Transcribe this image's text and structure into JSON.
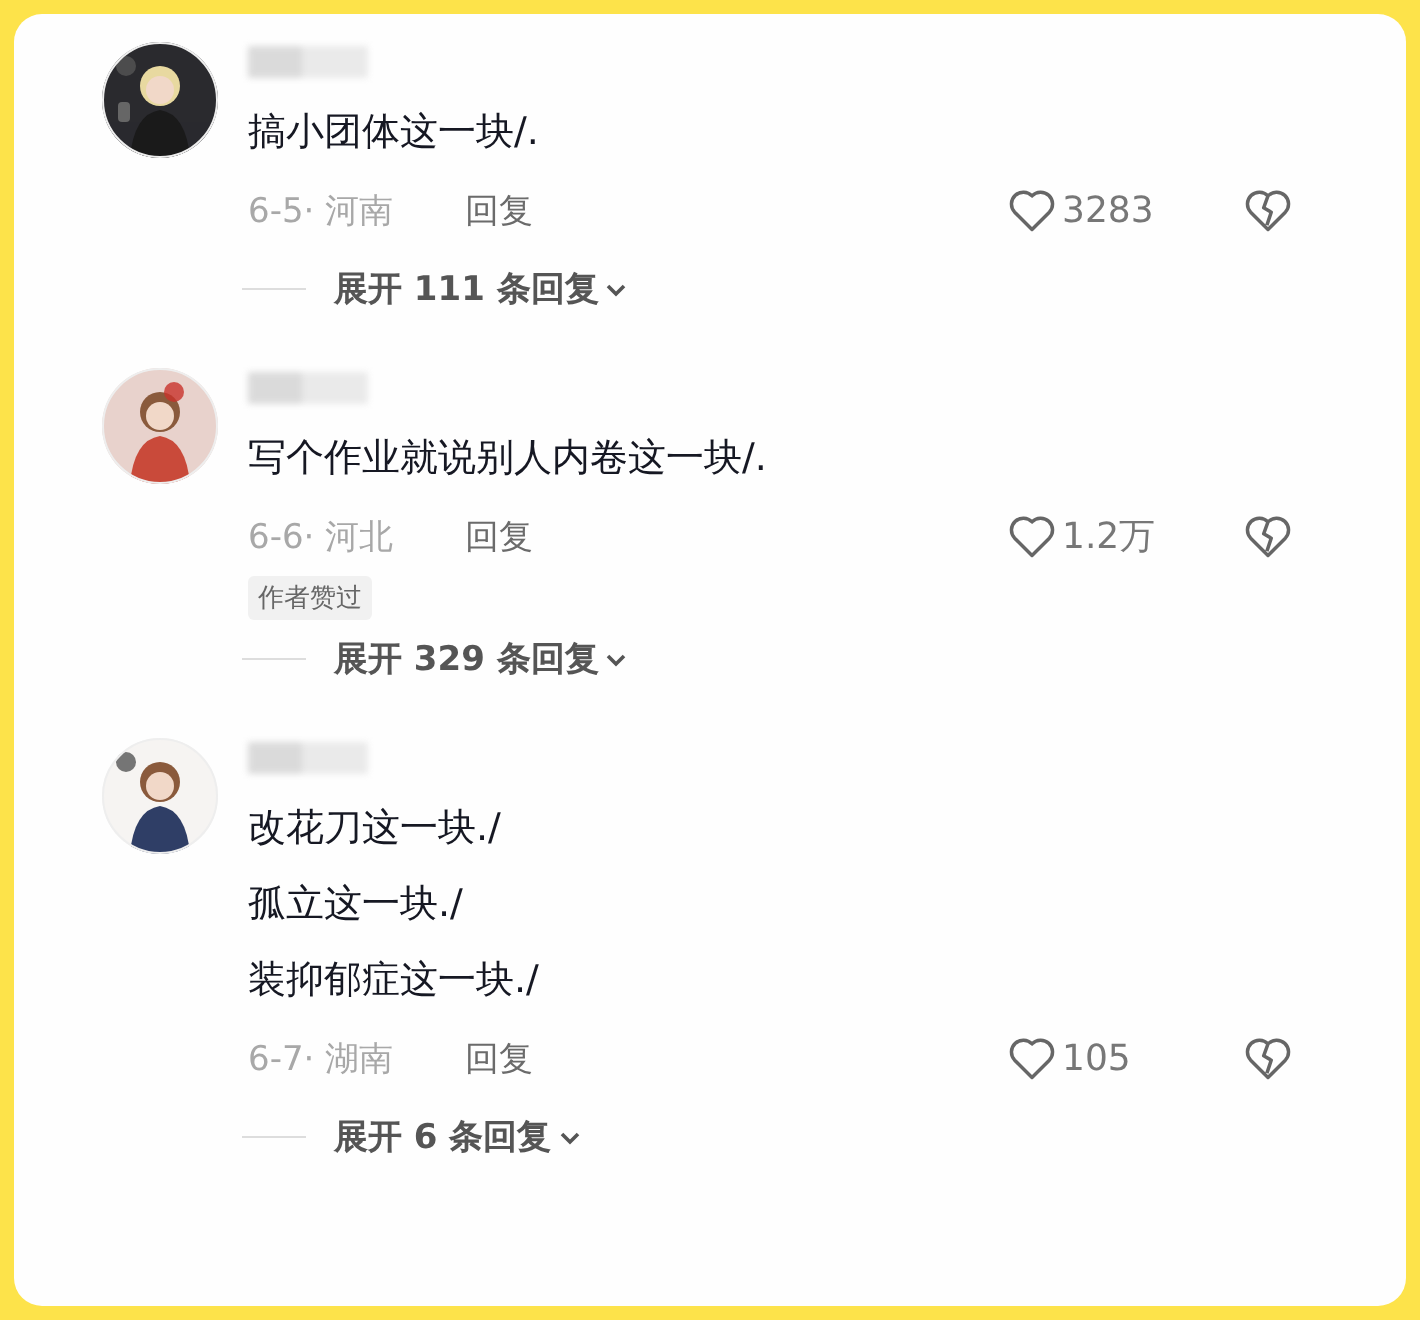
{
  "comments": [
    {
      "lines": [
        "搞小团体这一块/."
      ],
      "date_region": "6-5· 河南",
      "reply": "回复",
      "likes": "3283",
      "expand": "展开 111 条回复"
    },
    {
      "lines": [
        "写个作业就说别人内卷这一块/."
      ],
      "date_region": "6-6· 河北",
      "reply": "回复",
      "likes": "1.2万",
      "badge": "作者赞过",
      "expand": "展开 329 条回复"
    },
    {
      "lines": [
        "改花刀这一块./",
        "孤立这一块./",
        "装抑郁症这一块./"
      ],
      "date_region": "6-7· 湖南",
      "reply": "回复",
      "likes": "105",
      "expand": "展开 6 条回复"
    }
  ]
}
